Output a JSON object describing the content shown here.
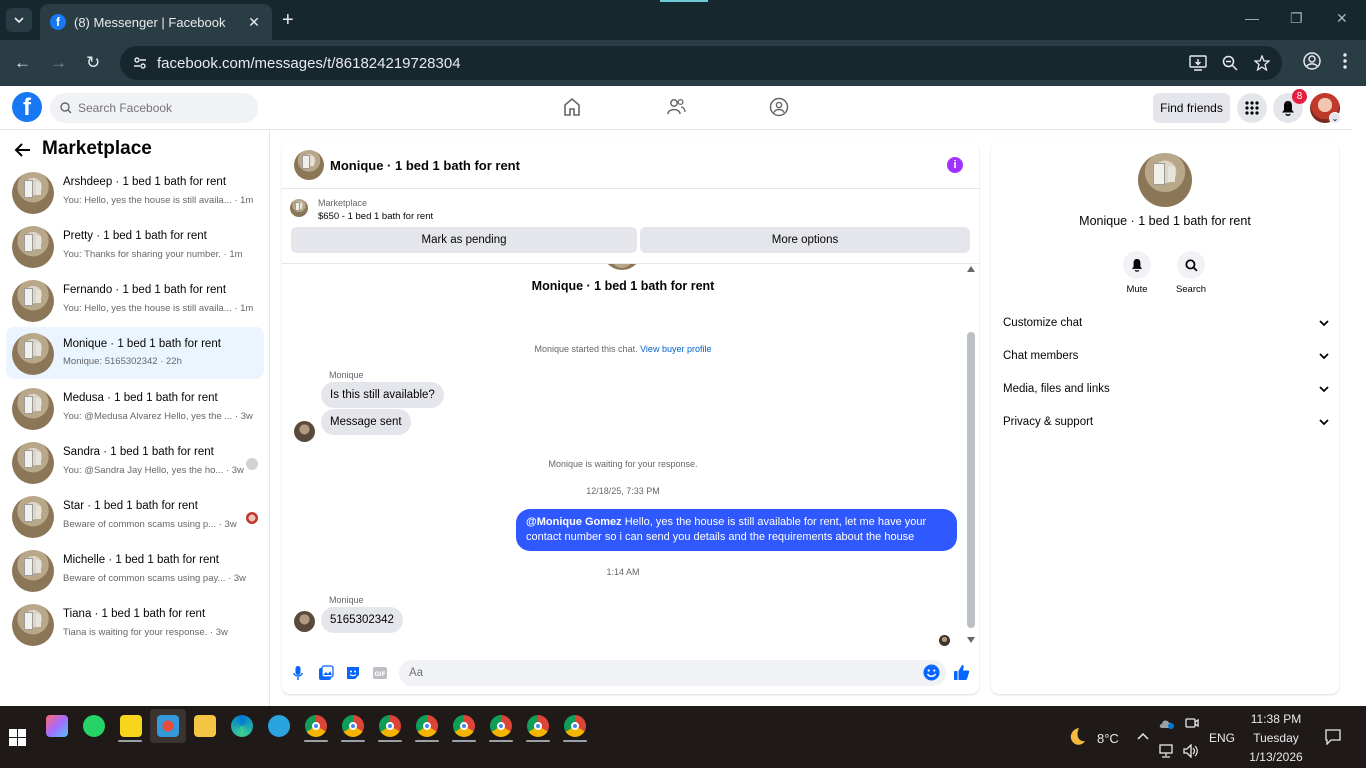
{
  "browser": {
    "tab_title": "(8) Messenger | Facebook",
    "url": "facebook.com/messages/t/861824219728304",
    "colors": {
      "frame": "#17272e",
      "toolbar": "#2b3d44"
    }
  },
  "fb": {
    "search_placeholder": "Search Facebook",
    "find_friends": "Find friends",
    "notification_count": "8",
    "brand_color": "#1877f2"
  },
  "sidebar": {
    "title": "Marketplace",
    "conversations": [
      {
        "name": "Arshdeep · 1 bed 1 bath for rent",
        "preview": "You: Hello, yes the house is still availa... · 1m"
      },
      {
        "name": "Pretty · 1 bed 1 bath for rent",
        "preview": "You: Thanks for sharing your number. · 1m"
      },
      {
        "name": "Fernando · 1 bed 1 bath for rent",
        "preview": "You: Hello, yes the house is still availa... · 1m"
      },
      {
        "name": "Monique · 1 bed 1 bath for rent",
        "preview": "Monique: 5165302342 · 22h"
      },
      {
        "name": "Medusa · 1 bed 1 bath for rent",
        "preview": "You: @Medusa Alvarez Hello, yes the ... · 3w"
      },
      {
        "name": "Sandra · 1 bed 1 bath for rent",
        "preview": "You: @Sandra Jay Hello, yes the ho... · 3w"
      },
      {
        "name": "Star · 1 bed 1 bath for rent",
        "preview": "Beware of common scams using p... · 3w"
      },
      {
        "name": "Michelle · 1 bed 1 bath for rent",
        "preview": "Beware of common scams using pay... · 3w"
      },
      {
        "name": "Tiana · 1 bed 1 bath for rent",
        "preview": "Tiana is waiting for your response. · 3w"
      }
    ]
  },
  "chat": {
    "title": "Monique · 1 bed 1 bath for rent",
    "marketplace_label": "Marketplace",
    "listing": "$650 - 1 bed 1 bath for rent",
    "mark_pending": "Mark as pending",
    "more_options": "More options",
    "started_text": "Monique started this chat.",
    "buyer_profile_link": "View buyer profile",
    "sender_name": "Monique",
    "msg1": "Is this still available?",
    "msg2": "Message sent",
    "waiting_text": "Monique is waiting for your response.",
    "timestamp1": "12/18/25, 7:33 PM",
    "out_mention": "@Monique Gomez",
    "out_text": "Hello, yes the house is still available for rent, let me have your contact number so i can send you details and the requirements about the house",
    "timestamp2": "1:14 AM",
    "msg3": "5165302342",
    "composer_placeholder": "Aa",
    "outgoing_color": "#2f58ff"
  },
  "details": {
    "name": "Monique · 1 bed 1 bath for rent",
    "mute": "Mute",
    "search": "Search",
    "sections": [
      "Customize chat",
      "Chat members",
      "Media, files and links",
      "Privacy & support"
    ]
  },
  "taskbar": {
    "temperature": "8°C",
    "language": "ENG",
    "time": "11:38 PM",
    "day": "Tuesday",
    "date": "1/13/2026"
  }
}
